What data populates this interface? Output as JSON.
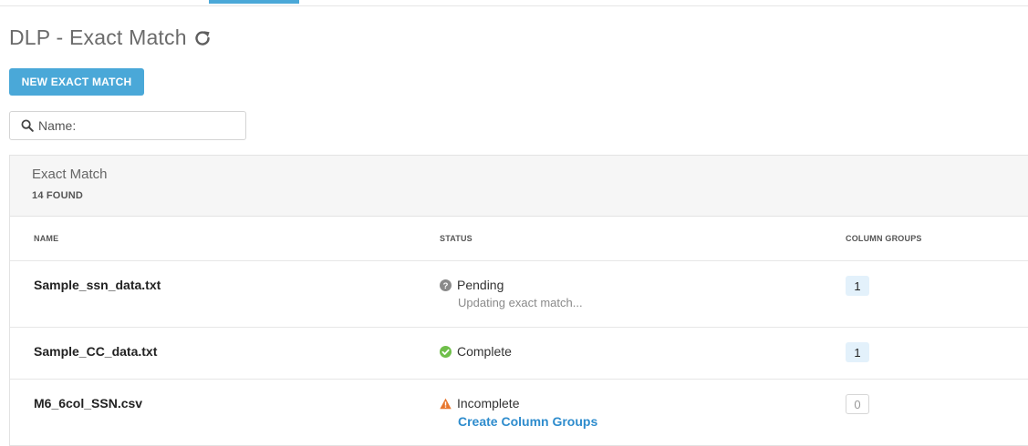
{
  "header": {
    "title": "DLP - Exact Match",
    "refresh_icon": "refresh-icon"
  },
  "toolbar": {
    "new_button_label": "NEW EXACT MATCH"
  },
  "search": {
    "placeholder": "Name:",
    "value": ""
  },
  "panel": {
    "title": "Exact Match",
    "found": "14 FOUND"
  },
  "table": {
    "columns": [
      "NAME",
      "STATUS",
      "COLUMN GROUPS"
    ],
    "rows": [
      {
        "name": "Sample_ssn_data.txt",
        "status": "Pending",
        "status_icon": "help-circle-icon",
        "detail": "Updating exact match...",
        "column_groups": "1"
      },
      {
        "name": "Sample_CC_data.txt",
        "status": "Complete",
        "status_icon": "check-circle-icon",
        "column_groups": "1"
      },
      {
        "name": "M6_6col_SSN.csv",
        "status": "Incomplete",
        "status_icon": "warning-icon",
        "action": "Create Column Groups",
        "column_groups": "0"
      }
    ]
  },
  "colors": {
    "accent": "#4aa8d8",
    "link": "#2e8ccd",
    "pending": "#8a8a8a",
    "complete": "#6fbf4a",
    "warning": "#e8772e"
  }
}
